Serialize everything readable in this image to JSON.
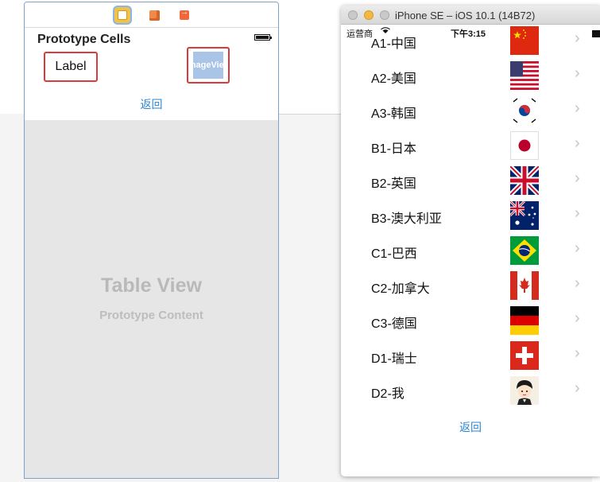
{
  "storyboard": {
    "section_title": "Prototype Cells",
    "cell_label": "Label",
    "image_placeholder": "ImageView",
    "back_button": "返回",
    "table_view_title": "Table View",
    "table_view_subtitle": "Prototype Content",
    "dock_icons": [
      "view-controller-icon",
      "first-responder-icon",
      "exit-icon"
    ]
  },
  "simulator": {
    "window_title": "iPhone SE – iOS 10.1 (14B72)",
    "status": {
      "carrier": "运营商",
      "time": "下午3:15"
    },
    "rows": [
      {
        "label": "A1-中国",
        "flag": "china"
      },
      {
        "label": "A2-美国",
        "flag": "usa"
      },
      {
        "label": "A3-韩国",
        "flag": "korea"
      },
      {
        "label": "B1-日本",
        "flag": "japan"
      },
      {
        "label": "B2-英国",
        "flag": "uk"
      },
      {
        "label": "B3-澳大利亚",
        "flag": "australia"
      },
      {
        "label": "C1-巴西",
        "flag": "brazil"
      },
      {
        "label": "C2-加拿大",
        "flag": "canada"
      },
      {
        "label": "C3-德国",
        "flag": "germany"
      },
      {
        "label": "D1-瑞士",
        "flag": "switzerland"
      },
      {
        "label": "D2-我",
        "flag": "avatar"
      }
    ],
    "back_button": "返回"
  },
  "colors": {
    "accent": "#2f86d6",
    "selection": "#d93a3a"
  }
}
